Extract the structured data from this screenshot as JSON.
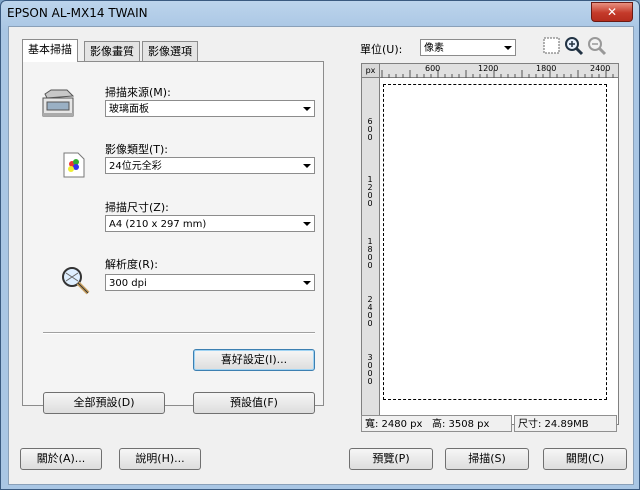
{
  "window": {
    "title": "EPSON AL-MX14 TWAIN",
    "close_label": "✕"
  },
  "tabs": [
    {
      "label": "基本掃描",
      "active": true
    },
    {
      "label": "影像畫質",
      "active": false
    },
    {
      "label": "影像選項",
      "active": false
    }
  ],
  "fields": {
    "source": {
      "label": "掃描來源(M):",
      "value": "玻璃面板"
    },
    "image_type": {
      "label": "影像類型(T):",
      "value": "24位元全彩"
    },
    "size": {
      "label": "掃描尺寸(Z):",
      "value": "A4 (210 x 297 mm)"
    },
    "resolution": {
      "label": "解析度(R):",
      "value": "300 dpi"
    }
  },
  "buttons": {
    "preferences": "喜好設定(I)...",
    "reset_all": "全部預設(D)",
    "defaults": "預設值(F)",
    "about": "關於(A)...",
    "help": "說明(H)...",
    "preview": "預覽(P)",
    "scan": "掃描(S)",
    "close": "關閉(C)"
  },
  "units": {
    "label": "單位(U):",
    "value": "像素"
  },
  "ruler": {
    "corner": "px",
    "h_ticks": [
      "600",
      "1200",
      "1800",
      "2400"
    ],
    "v_ticks": [
      "600",
      "1200",
      "1800",
      "2400",
      "3000"
    ]
  },
  "status": {
    "width": "寬: 2480 px",
    "height": "高: 3508 px",
    "size": "尺寸: 24.89MB"
  }
}
